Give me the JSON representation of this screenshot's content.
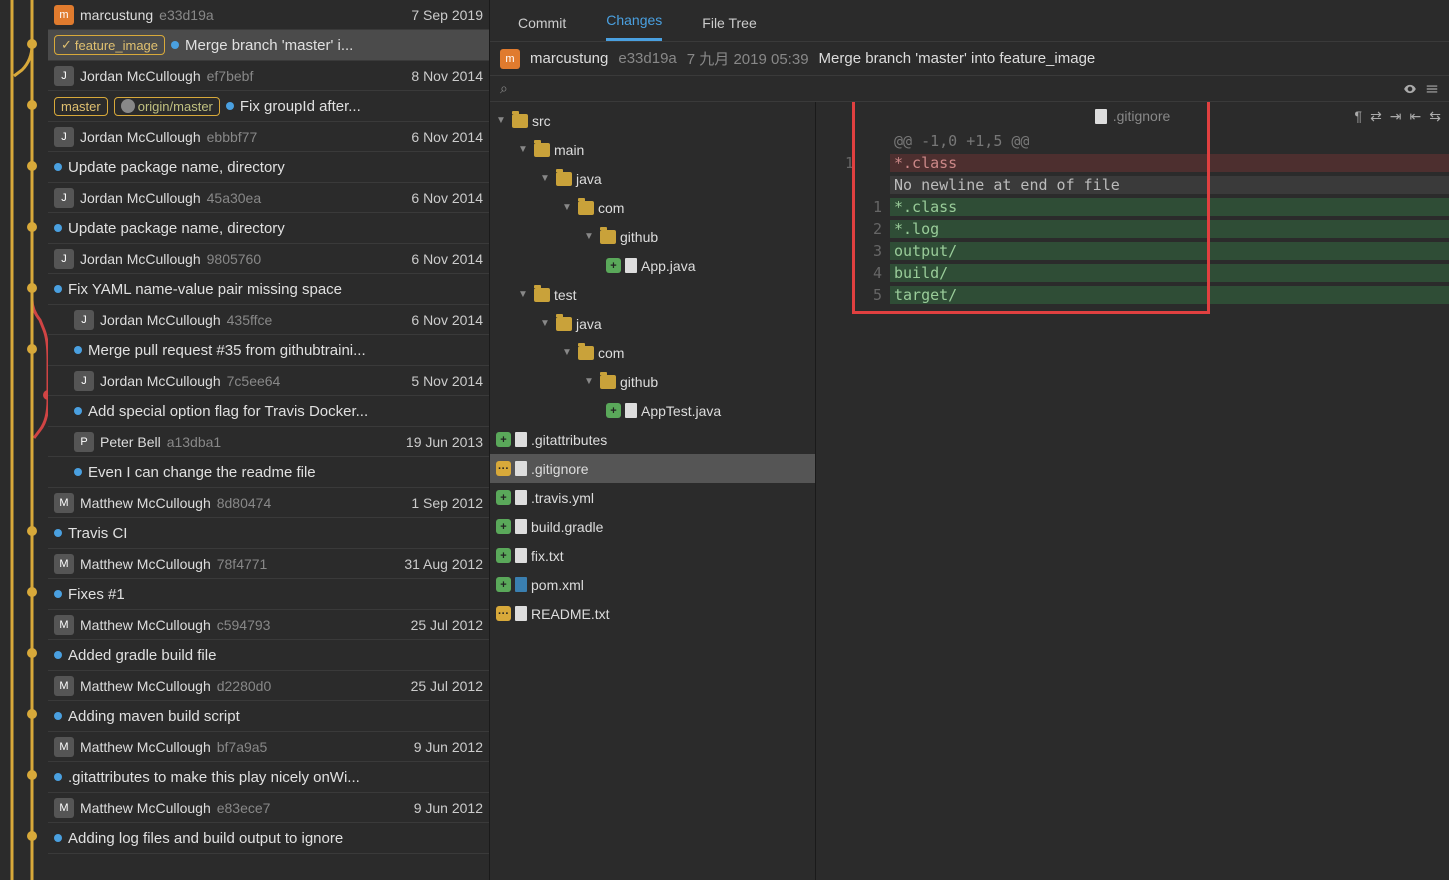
{
  "commits": [
    {
      "author": "marcustung",
      "hash": "e33d19a",
      "date": "7 Sep 2019",
      "avatar": "m",
      "avatarCls": "orange",
      "indent": 0
    },
    {
      "msg": "Merge branch 'master' i...",
      "branches": [
        "feature_image"
      ],
      "checked": true,
      "sel": true,
      "indent": 0
    },
    {
      "author": "Jordan McCullough",
      "hash": "ef7bebf",
      "date": "8 Nov 2014",
      "avatar": "J",
      "indent": 0
    },
    {
      "msg": "Fix groupId after...",
      "branches": [
        "master"
      ],
      "remote": "origin/master",
      "indent": 0
    },
    {
      "author": "Jordan McCullough",
      "hash": "ebbbf77",
      "date": "6 Nov 2014",
      "avatar": "J",
      "indent": 0
    },
    {
      "msg": "Update package name, directory",
      "indent": 0
    },
    {
      "author": "Jordan McCullough",
      "hash": "45a30ea",
      "date": "6 Nov 2014",
      "avatar": "J",
      "indent": 0
    },
    {
      "msg": "Update package name, directory",
      "indent": 0
    },
    {
      "author": "Jordan McCullough",
      "hash": "9805760",
      "date": "6 Nov 2014",
      "avatar": "J",
      "indent": 0
    },
    {
      "msg": "Fix YAML name-value pair missing space",
      "indent": 0
    },
    {
      "author": "Jordan McCullough",
      "hash": "435ffce",
      "date": "6 Nov 2014",
      "avatar": "J",
      "indent": 20
    },
    {
      "msg": "Merge pull request #35 from githubtraini...",
      "indent": 20
    },
    {
      "author": "Jordan McCullough",
      "hash": "7c5ee64",
      "date": "5 Nov 2014",
      "avatar": "J",
      "indent": 20
    },
    {
      "msg": "Add special option flag for Travis Docker...",
      "indent": 20
    },
    {
      "author": "Peter Bell",
      "hash": "a13dba1",
      "date": "19 Jun 2013",
      "avatar": "P",
      "indent": 20
    },
    {
      "msg": "Even I can change the readme file",
      "indent": 20
    },
    {
      "author": "Matthew McCullough",
      "hash": "8d80474",
      "date": "1 Sep 2012",
      "avatar": "M",
      "indent": 0
    },
    {
      "msg": "Travis CI",
      "indent": 0
    },
    {
      "author": "Matthew McCullough",
      "hash": "78f4771",
      "date": "31 Aug 2012",
      "avatar": "M",
      "indent": 0
    },
    {
      "msg": "Fixes #1",
      "indent": 0
    },
    {
      "author": "Matthew McCullough",
      "hash": "c594793",
      "date": "25 Jul 2012",
      "avatar": "M",
      "indent": 0
    },
    {
      "msg": "Added gradle build file",
      "indent": 0
    },
    {
      "author": "Matthew McCullough",
      "hash": "d2280d0",
      "date": "25 Jul 2012",
      "avatar": "M",
      "indent": 0
    },
    {
      "msg": "Adding maven build script",
      "indent": 0
    },
    {
      "author": "Matthew McCullough",
      "hash": "bf7a9a5",
      "date": "9 Jun 2012",
      "avatar": "M",
      "indent": 0
    },
    {
      "msg": ".gitattributes to make this play nicely onWi...",
      "indent": 0
    },
    {
      "author": "Matthew McCullough",
      "hash": "e83ece7",
      "date": "9 Jun 2012",
      "avatar": "M",
      "indent": 0
    },
    {
      "msg": "Adding log files and build output to ignore",
      "indent": 0
    }
  ],
  "tabs": {
    "commit": "Commit",
    "changes": "Changes",
    "fileTree": "File Tree"
  },
  "commitHeader": {
    "author": "marcustung",
    "hash": "e33d19a",
    "date": "7 九月 2019 05:39",
    "msg": "Merge branch 'master' into feature_image"
  },
  "search": {
    "icon": "🔍",
    "placeholder": ""
  },
  "tree": [
    {
      "type": "folder",
      "name": "src",
      "indent": 0,
      "open": true
    },
    {
      "type": "folder",
      "name": "main",
      "indent": 1,
      "open": true
    },
    {
      "type": "folder",
      "name": "java",
      "indent": 2,
      "open": true
    },
    {
      "type": "folder",
      "name": "com",
      "indent": 3,
      "open": true
    },
    {
      "type": "folder",
      "name": "github",
      "indent": 4,
      "open": true
    },
    {
      "type": "file",
      "name": "App.java",
      "indent": 5,
      "status": "add"
    },
    {
      "type": "folder",
      "name": "test",
      "indent": 1,
      "open": true
    },
    {
      "type": "folder",
      "name": "java",
      "indent": 2,
      "open": true
    },
    {
      "type": "folder",
      "name": "com",
      "indent": 3,
      "open": true
    },
    {
      "type": "folder",
      "name": "github",
      "indent": 4,
      "open": true
    },
    {
      "type": "file",
      "name": "AppTest.java",
      "indent": 5,
      "status": "add"
    },
    {
      "type": "file",
      "name": ".gitattributes",
      "indent": 0,
      "status": "add"
    },
    {
      "type": "file",
      "name": ".gitignore",
      "indent": 0,
      "status": "mod",
      "sel": true
    },
    {
      "type": "file",
      "name": ".travis.yml",
      "indent": 0,
      "status": "add"
    },
    {
      "type": "file",
      "name": "build.gradle",
      "indent": 0,
      "status": "add"
    },
    {
      "type": "file",
      "name": "fix.txt",
      "indent": 0,
      "status": "add"
    },
    {
      "type": "file",
      "name": "pom.xml",
      "indent": 0,
      "status": "add",
      "xml": true
    },
    {
      "type": "file",
      "name": "README.txt",
      "indent": 0,
      "status": "mod"
    }
  ],
  "diff": {
    "filename": ".gitignore",
    "lines": [
      {
        "g1": "",
        "g2": "",
        "cls": "hunk",
        "text": "@@ -1,0 +1,5 @@"
      },
      {
        "g1": "1",
        "g2": "",
        "cls": "del",
        "text": "*.class"
      },
      {
        "g1": "",
        "g2": "",
        "cls": "note",
        "text": "No newline at end of file"
      },
      {
        "g1": "",
        "g2": "1",
        "cls": "add-ln",
        "text": "*.class"
      },
      {
        "g1": "",
        "g2": "2",
        "cls": "add-ln",
        "text": "*.log"
      },
      {
        "g1": "",
        "g2": "3",
        "cls": "add-ln",
        "text": "output/"
      },
      {
        "g1": "",
        "g2": "4",
        "cls": "add-ln",
        "text": "build/"
      },
      {
        "g1": "",
        "g2": "5",
        "cls": "add-ln",
        "text": "target/"
      }
    ],
    "toolbar": [
      "¶",
      "⇄",
      "⇥",
      "⇤",
      "⇆"
    ]
  }
}
